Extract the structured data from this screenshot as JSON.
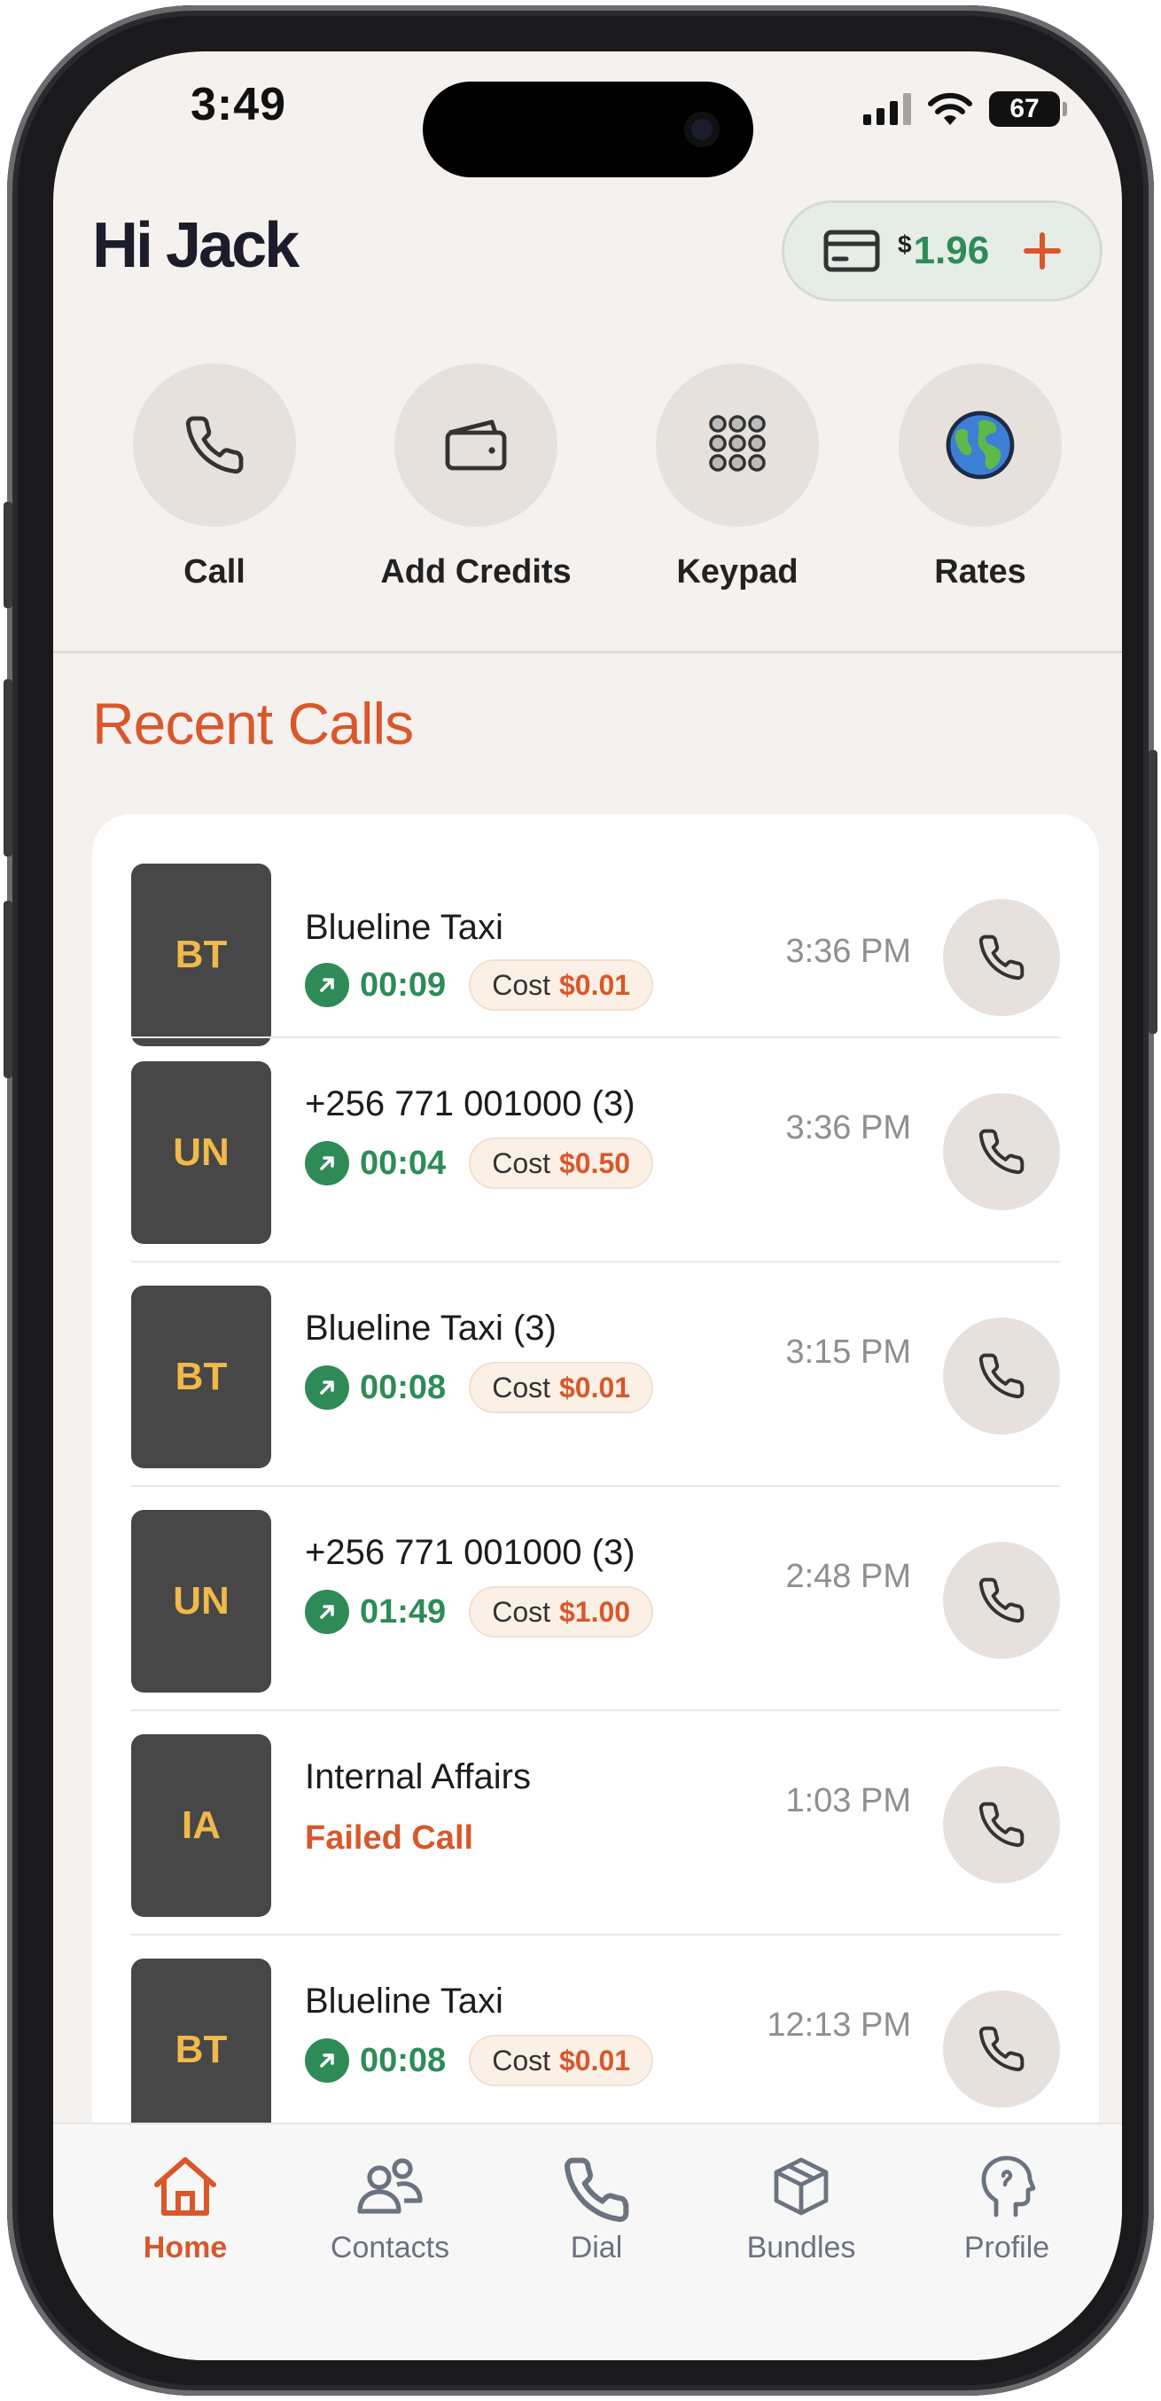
{
  "status_bar": {
    "time": "3:49",
    "battery": "67"
  },
  "header": {
    "greeting": "Hi Jack",
    "balance_currency": "$",
    "balance_value": "1.96"
  },
  "quick_actions": [
    {
      "label": "Call",
      "icon": "phone-icon"
    },
    {
      "label": "Add Credits",
      "icon": "wallet-icon"
    },
    {
      "label": "Keypad",
      "icon": "keypad-icon"
    },
    {
      "label": "Rates",
      "icon": "globe-icon"
    }
  ],
  "recent_calls": {
    "title": "Recent Calls",
    "cost_label": "Cost",
    "items": [
      {
        "initials": "BT",
        "name": "Blueline Taxi",
        "duration": "00:09",
        "cost": "$0.01",
        "time": "3:36 PM",
        "status": "completed"
      },
      {
        "initials": "UN",
        "name": "+256 771 001000 (3)",
        "duration": "00:04",
        "cost": "$0.50",
        "time": "3:36 PM",
        "status": "completed"
      },
      {
        "initials": "BT",
        "name": "Blueline Taxi (3)",
        "duration": "00:08",
        "cost": "$0.01",
        "time": "3:15 PM",
        "status": "completed"
      },
      {
        "initials": "UN",
        "name": "+256 771 001000 (3)",
        "duration": "01:49",
        "cost": "$1.00",
        "time": "2:48 PM",
        "status": "completed"
      },
      {
        "initials": "IA",
        "name": "Internal Affairs",
        "failed_text": "Failed Call",
        "time": "1:03 PM",
        "status": "failed"
      },
      {
        "initials": "BT",
        "name": "Blueline Taxi",
        "duration": "00:08",
        "cost": "$0.01",
        "time": "12:13 PM",
        "status": "completed"
      }
    ]
  },
  "tab_bar": [
    {
      "label": "Home",
      "icon": "home-icon",
      "active": true
    },
    {
      "label": "Contacts",
      "icon": "contacts-icon",
      "active": false
    },
    {
      "label": "Dial",
      "icon": "dial-icon",
      "active": false
    },
    {
      "label": "Bundles",
      "icon": "bundles-icon",
      "active": false
    },
    {
      "label": "Profile",
      "icon": "profile-icon",
      "active": false
    }
  ],
  "colors": {
    "accent": "#d9572a",
    "green": "#2e8b57",
    "avatar_bg": "#474747",
    "avatar_text": "#f0b94a",
    "background": "#f4f1ef"
  }
}
